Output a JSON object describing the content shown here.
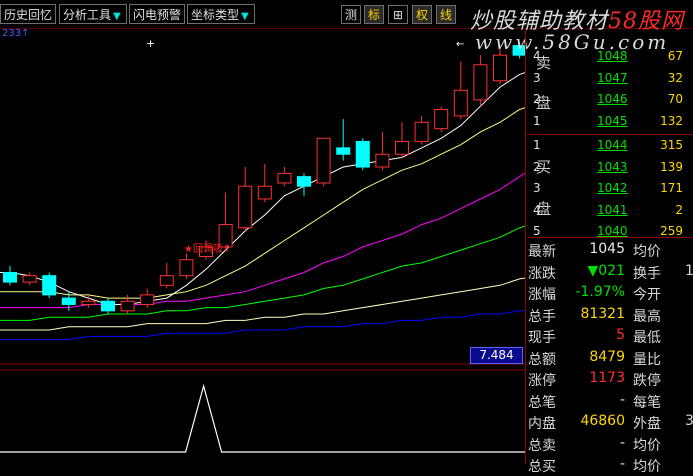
{
  "toolbar": {
    "buttons": [
      {
        "label": "历史回忆",
        "dropdown": false
      },
      {
        "label": "分析工具",
        "dropdown": true
      },
      {
        "label": "闪电预警",
        "dropdown": false
      },
      {
        "label": "坐标类型",
        "dropdown": true
      }
    ],
    "small_buttons": [
      "测",
      "标",
      "⊞",
      "权",
      "线"
    ]
  },
  "watermark": {
    "line1_a": "炒股辅助教材",
    "line1_b": "58股网",
    "line2": "www.58Gu.com"
  },
  "chart": {
    "top_code": "233↑",
    "signal_label": "★回调吸↑",
    "current_price_box": "7.484",
    "colors": {
      "up": "#ff3030",
      "down": "#00ffff",
      "ma5": "#ffffff",
      "ma10": "#ffff80",
      "ma20": "#ff00ff",
      "ma30": "#00ff00",
      "ma60": "#ffffc0",
      "ma120": "#0000ff"
    },
    "candles": [
      {
        "o": 10.28,
        "c": 10.25,
        "h": 10.3,
        "l": 10.24
      },
      {
        "o": 10.25,
        "c": 10.27,
        "h": 10.28,
        "l": 10.24
      },
      {
        "o": 10.27,
        "c": 10.21,
        "h": 10.28,
        "l": 10.2
      },
      {
        "o": 10.2,
        "c": 10.18,
        "h": 10.22,
        "l": 10.16
      },
      {
        "o": 10.18,
        "c": 10.19,
        "h": 10.21,
        "l": 10.17
      },
      {
        "o": 10.19,
        "c": 10.16,
        "h": 10.2,
        "l": 10.15
      },
      {
        "o": 10.16,
        "c": 10.19,
        "h": 10.21,
        "l": 10.15
      },
      {
        "o": 10.18,
        "c": 10.21,
        "h": 10.23,
        "l": 10.17
      },
      {
        "o": 10.24,
        "c": 10.27,
        "h": 10.31,
        "l": 10.23
      },
      {
        "o": 10.27,
        "c": 10.32,
        "h": 10.34,
        "l": 10.26
      },
      {
        "o": 10.33,
        "c": 10.36,
        "h": 10.38,
        "l": 10.32
      },
      {
        "o": 10.36,
        "c": 10.43,
        "h": 10.53,
        "l": 10.35
      },
      {
        "o": 10.42,
        "c": 10.55,
        "h": 10.61,
        "l": 10.41
      },
      {
        "o": 10.51,
        "c": 10.55,
        "h": 10.62,
        "l": 10.5
      },
      {
        "o": 10.56,
        "c": 10.59,
        "h": 10.61,
        "l": 10.55
      },
      {
        "o": 10.58,
        "c": 10.55,
        "h": 10.59,
        "l": 10.52
      },
      {
        "o": 10.56,
        "c": 10.7,
        "h": 10.7,
        "l": 10.55
      },
      {
        "o": 10.67,
        "c": 10.65,
        "h": 10.76,
        "l": 10.63
      },
      {
        "o": 10.69,
        "c": 10.61,
        "h": 10.7,
        "l": 10.6
      },
      {
        "o": 10.61,
        "c": 10.65,
        "h": 10.72,
        "l": 10.6
      },
      {
        "o": 10.65,
        "c": 10.69,
        "h": 10.75,
        "l": 10.64
      },
      {
        "o": 10.69,
        "c": 10.75,
        "h": 10.77,
        "l": 10.68
      },
      {
        "o": 10.73,
        "c": 10.79,
        "h": 10.8,
        "l": 10.72
      },
      {
        "o": 10.77,
        "c": 10.85,
        "h": 10.94,
        "l": 10.76
      },
      {
        "o": 10.82,
        "c": 10.93,
        "h": 10.96,
        "l": 10.8
      },
      {
        "o": 10.88,
        "c": 10.96,
        "h": 10.98,
        "l": 10.87
      },
      {
        "o": 10.99,
        "c": 10.96,
        "h": 11.0,
        "l": 10.95
      },
      {
        "o": 10.94,
        "c": 10.91,
        "h": 10.97,
        "l": 10.89
      }
    ],
    "ma5": [
      10.28,
      10.27,
      10.25,
      10.22,
      10.2,
      10.18,
      10.18,
      10.19,
      10.2,
      10.24,
      10.29,
      10.35,
      10.41,
      10.46,
      10.52,
      10.55,
      10.58,
      10.61,
      10.62,
      10.63,
      10.64,
      10.67,
      10.7,
      10.74,
      10.8,
      10.86,
      10.9,
      10.92
    ],
    "ma10": [
      10.22,
      10.22,
      10.22,
      10.21,
      10.21,
      10.2,
      10.2,
      10.2,
      10.21,
      10.22,
      10.24,
      10.27,
      10.3,
      10.34,
      10.38,
      10.42,
      10.46,
      10.5,
      10.54,
      10.57,
      10.6,
      10.62,
      10.65,
      10.68,
      10.72,
      10.75,
      10.79,
      10.81
    ],
    "ma20": [
      10.17,
      10.17,
      10.17,
      10.17,
      10.18,
      10.18,
      10.18,
      10.18,
      10.19,
      10.19,
      10.2,
      10.21,
      10.22,
      10.24,
      10.26,
      10.28,
      10.31,
      10.33,
      10.36,
      10.38,
      10.4,
      10.43,
      10.45,
      10.48,
      10.51,
      10.54,
      10.58,
      10.62
    ],
    "ma30": [
      10.13,
      10.13,
      10.14,
      10.14,
      10.14,
      10.15,
      10.15,
      10.15,
      10.16,
      10.16,
      10.17,
      10.17,
      10.18,
      10.19,
      10.2,
      10.21,
      10.23,
      10.24,
      10.26,
      10.28,
      10.3,
      10.31,
      10.33,
      10.35,
      10.37,
      10.39,
      10.42,
      10.44
    ],
    "ma60": [
      10.1,
      10.1,
      10.1,
      10.11,
      10.11,
      10.11,
      10.11,
      10.12,
      10.12,
      10.12,
      10.12,
      10.13,
      10.13,
      10.14,
      10.14,
      10.15,
      10.15,
      10.16,
      10.17,
      10.18,
      10.19,
      10.2,
      10.21,
      10.22,
      10.23,
      10.24,
      10.26,
      10.27
    ],
    "ma120": [
      10.07,
      10.07,
      10.07,
      10.07,
      10.08,
      10.08,
      10.08,
      10.08,
      10.09,
      10.09,
      10.09,
      10.09,
      10.1,
      10.1,
      10.1,
      10.11,
      10.11,
      10.11,
      10.12,
      10.12,
      10.13,
      10.13,
      10.14,
      10.14,
      10.15,
      10.15,
      10.16,
      10.16
    ],
    "indicator": [
      0,
      0,
      0,
      0,
      0,
      0,
      0,
      0,
      0,
      0,
      0,
      1,
      0,
      0,
      0,
      0,
      0,
      0,
      0,
      0,
      0,
      0,
      0,
      0,
      0,
      0,
      0,
      0
    ]
  },
  "orderbook": {
    "sell_label": "卖盘",
    "buy_label": "买盘",
    "sell": [
      {
        "n": "4",
        "price": "1048",
        "vol": "67"
      },
      {
        "n": "3",
        "price": "1047",
        "vol": "32"
      },
      {
        "n": "2",
        "price": "1046",
        "vol": "70"
      },
      {
        "n": "1",
        "price": "1045",
        "vol": "132"
      }
    ],
    "buy": [
      {
        "n": "1",
        "price": "1044",
        "vol": "315"
      },
      {
        "n": "2",
        "price": "1043",
        "vol": "139"
      },
      {
        "n": "3",
        "price": "1042",
        "vol": "171"
      },
      {
        "n": "4",
        "price": "1041",
        "vol": "2"
      },
      {
        "n": "5",
        "price": "1040",
        "vol": "259"
      }
    ]
  },
  "quote": [
    {
      "l1": "最新",
      "v1": "1045",
      "v1c": "white",
      "l2": "均价",
      "v2": ""
    },
    {
      "l1": "涨跌",
      "v1": "▼021",
      "v1c": "green",
      "l2": "换手",
      "v2": "1"
    },
    {
      "l1": "涨幅",
      "v1": "-1.97%",
      "v1c": "green",
      "l2": "今开",
      "v2": ""
    },
    {
      "l1": "总手",
      "v1": "81321",
      "v1c": "yel",
      "l2": "最高",
      "v2": ""
    },
    {
      "l1": "现手",
      "v1": "5",
      "v1c": "red",
      "l2": "最低",
      "v2": ""
    },
    {
      "l1": "总额",
      "v1": "8479",
      "v1c": "yel",
      "l2": "量比",
      "v2": ""
    },
    {
      "l1": "涨停",
      "v1": "1173",
      "v1c": "red",
      "l2": "跌停",
      "v2": ""
    },
    {
      "l1": "总笔",
      "v1": "-",
      "v1c": "white",
      "l2": "每笔",
      "v2": ""
    },
    {
      "l1": "内盘",
      "v1": "46860",
      "v1c": "yel",
      "l2": "外盘",
      "v2": "3"
    },
    {
      "l1": "总卖",
      "v1": "-",
      "v1c": "white",
      "l2": "均价",
      "v2": ""
    },
    {
      "l1": "总买",
      "v1": "-",
      "v1c": "white",
      "l2": "均价",
      "v2": ""
    }
  ]
}
